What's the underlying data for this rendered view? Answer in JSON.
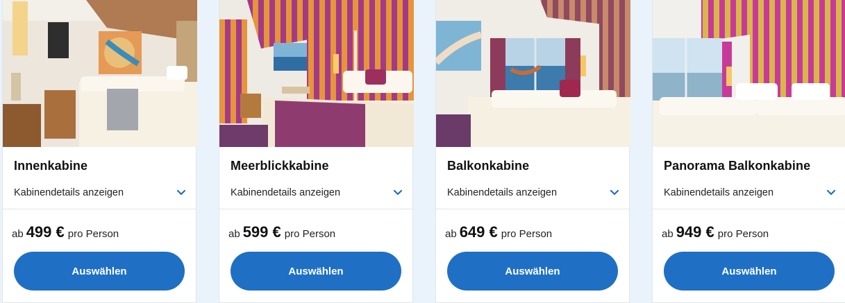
{
  "cabins": [
    {
      "name": "Innenkabine",
      "details_label": "Kabinendetails anzeigen",
      "price_prefix": "ab",
      "price": "499 €",
      "price_suffix": "pro Person",
      "button_label": "Auswählen"
    },
    {
      "name": "Meerblickkabine",
      "details_label": "Kabinendetails anzeigen",
      "price_prefix": "ab",
      "price": "599 €",
      "price_suffix": "pro Person",
      "button_label": "Auswählen"
    },
    {
      "name": "Balkonkabine",
      "details_label": "Kabinendetails anzeigen",
      "price_prefix": "ab",
      "price": "649 €",
      "price_suffix": "pro Person",
      "button_label": "Auswählen"
    },
    {
      "name": "Panorama Balkonkabine",
      "details_label": "Kabinendetails anzeigen",
      "price_prefix": "ab",
      "price": "949 €",
      "price_suffix": "pro Person",
      "button_label": "Auswählen"
    }
  ],
  "icons": {
    "expand": "chevron-down-icon"
  },
  "colors": {
    "accent": "#1f6fc5",
    "page_background": "#eaf3fb",
    "card_background": "#ffffff"
  }
}
